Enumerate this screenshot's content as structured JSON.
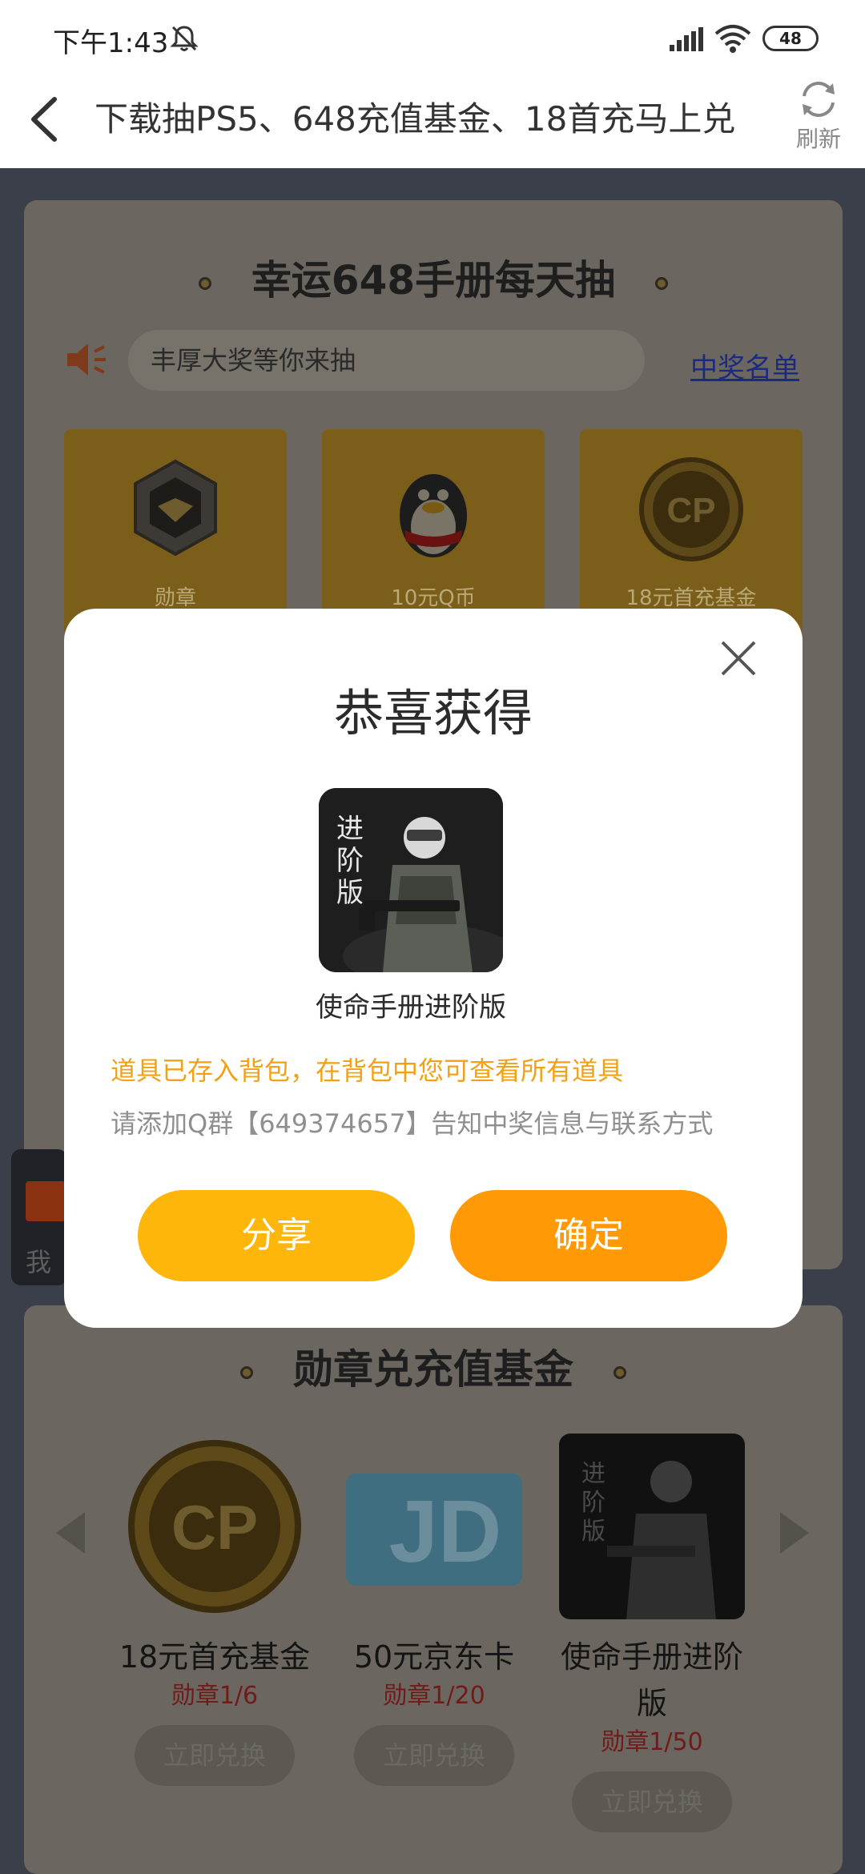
{
  "status_bar": {
    "time": "下午1:43",
    "battery": "48"
  },
  "header": {
    "title": "下载抽PS5、648充值基金、18首充马上兑",
    "refresh_label": "刷新"
  },
  "lottery": {
    "title": "幸运648手册每天抽",
    "notice": "丰厚大奖等你来抽",
    "winners_link": "中奖名单",
    "prizes": [
      {
        "label": "勋章",
        "icon": "medal-icon"
      },
      {
        "label": "10元Q币",
        "icon": "qq-penguin-icon"
      },
      {
        "label": "18元首充基金",
        "icon": "cp-coin-icon"
      }
    ]
  },
  "left_float": {
    "label": "我的"
  },
  "exchange": {
    "title": "勋章兑充值基金",
    "items": [
      {
        "name": "18元首充基金",
        "cost": "勋章1/6",
        "button": "立即兑换",
        "icon": "cp-coin-icon"
      },
      {
        "name": "50元京东卡",
        "cost": "勋章1/20",
        "button": "立即兑换",
        "icon": "jd-card-icon"
      },
      {
        "name": "使命手册进阶版",
        "cost": "勋章1/50",
        "button": "立即兑换",
        "icon": "soldier-icon"
      }
    ]
  },
  "dialog": {
    "title": "恭喜获得",
    "item_name": "使命手册进阶版",
    "item_tag": "进阶版",
    "message_saved": "道具已存入背包，在背包中您可查看所有道具",
    "message_contact": "请添加Q群【649374657】告知中奖信息与联系方式",
    "share_label": "分享",
    "confirm_label": "确定"
  },
  "colors": {
    "primary_orange": "#ff9a06",
    "share_yellow": "#ffb60a",
    "notice_orange": "#f2a116"
  }
}
